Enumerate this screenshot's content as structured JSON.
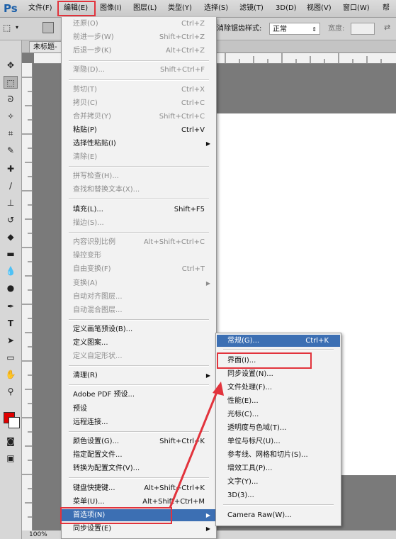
{
  "app": {
    "logo": "Ps"
  },
  "menubar": {
    "items": [
      {
        "label": "文件(F)"
      },
      {
        "label": "编辑(E)"
      },
      {
        "label": "图像(I)"
      },
      {
        "label": "图层(L)"
      },
      {
        "label": "类型(Y)"
      },
      {
        "label": "选择(S)"
      },
      {
        "label": "滤镜(T)"
      },
      {
        "label": "3D(D)"
      },
      {
        "label": "视图(V)"
      },
      {
        "label": "窗口(W)"
      },
      {
        "label": "帮"
      }
    ]
  },
  "options": {
    "partial_label": "消除锯齿",
    "style_label": "样式:",
    "style_value": "正常",
    "width_label": "宽度:"
  },
  "document": {
    "tab_title": "未标题-",
    "zoom": "100%"
  },
  "edit_menu": {
    "items": [
      {
        "label": "还原(O)",
        "shortcut": "Ctrl+Z",
        "disabled": true
      },
      {
        "label": "前进一步(W)",
        "shortcut": "Shift+Ctrl+Z",
        "disabled": true
      },
      {
        "label": "后退一步(K)",
        "shortcut": "Alt+Ctrl+Z",
        "disabled": true
      },
      {
        "label": "渐隐(D)...",
        "shortcut": "Shift+Ctrl+F",
        "disabled": true
      },
      {
        "label": "剪切(T)",
        "shortcut": "Ctrl+X",
        "disabled": true
      },
      {
        "label": "拷贝(C)",
        "shortcut": "Ctrl+C",
        "disabled": true
      },
      {
        "label": "合并拷贝(Y)",
        "shortcut": "Shift+Ctrl+C",
        "disabled": true
      },
      {
        "label": "粘贴(P)",
        "shortcut": "Ctrl+V",
        "disabled": false
      },
      {
        "label": "选择性粘贴(I)",
        "shortcut": "",
        "disabled": false
      },
      {
        "label": "清除(E)",
        "shortcut": "",
        "disabled": true
      },
      {
        "label": "拼写检查(H)...",
        "shortcut": "",
        "disabled": true
      },
      {
        "label": "查找和替换文本(X)...",
        "shortcut": "",
        "disabled": true
      },
      {
        "label": "填充(L)...",
        "shortcut": "Shift+F5",
        "disabled": false
      },
      {
        "label": "描边(S)...",
        "shortcut": "",
        "disabled": true
      },
      {
        "label": "内容识别比例",
        "shortcut": "Alt+Shift+Ctrl+C",
        "disabled": true
      },
      {
        "label": "操控变形",
        "shortcut": "",
        "disabled": true
      },
      {
        "label": "自由变换(F)",
        "shortcut": "Ctrl+T",
        "disabled": true
      },
      {
        "label": "变换(A)",
        "shortcut": "",
        "disabled": true
      },
      {
        "label": "自动对齐图层...",
        "shortcut": "",
        "disabled": true
      },
      {
        "label": "自动混合图层...",
        "shortcut": "",
        "disabled": true
      },
      {
        "label": "定义画笔预设(B)...",
        "shortcut": "",
        "disabled": false
      },
      {
        "label": "定义图案...",
        "shortcut": "",
        "disabled": false
      },
      {
        "label": "定义自定形状...",
        "shortcut": "",
        "disabled": true
      },
      {
        "label": "清理(R)",
        "shortcut": "",
        "disabled": false
      },
      {
        "label": "Adobe PDF 预设...",
        "shortcut": "",
        "disabled": false
      },
      {
        "label": "预设",
        "shortcut": "",
        "disabled": false
      },
      {
        "label": "远程连接...",
        "shortcut": "",
        "disabled": false
      },
      {
        "label": "颜色设置(G)...",
        "shortcut": "Shift+Ctrl+K",
        "disabled": false
      },
      {
        "label": "指定配置文件...",
        "shortcut": "",
        "disabled": false
      },
      {
        "label": "转换为配置文件(V)...",
        "shortcut": "",
        "disabled": false
      },
      {
        "label": "键盘快捷键...",
        "shortcut": "Alt+Shift+Ctrl+K",
        "disabled": false
      },
      {
        "label": "菜单(U)...",
        "shortcut": "Alt+Shift+Ctrl+M",
        "disabled": false
      },
      {
        "label": "首选项(N)",
        "shortcut": "",
        "disabled": false
      },
      {
        "label": "同步设置(E)",
        "shortcut": "",
        "disabled": false
      }
    ]
  },
  "preferences_submenu": {
    "items": [
      {
        "label": "常规(G)...",
        "shortcut": "Ctrl+K"
      },
      {
        "label": "界面(I)...",
        "shortcut": ""
      },
      {
        "label": "同步设置(N)...",
        "shortcut": ""
      },
      {
        "label": "文件处理(F)...",
        "shortcut": ""
      },
      {
        "label": "性能(E)...",
        "shortcut": ""
      },
      {
        "label": "光标(C)...",
        "shortcut": ""
      },
      {
        "label": "透明度与色域(T)...",
        "shortcut": ""
      },
      {
        "label": "单位与标尺(U)...",
        "shortcut": ""
      },
      {
        "label": "参考线、网格和切片(S)...",
        "shortcut": ""
      },
      {
        "label": "增效工具(P)...",
        "shortcut": ""
      },
      {
        "label": "文字(Y)...",
        "shortcut": ""
      },
      {
        "label": "3D(3)...",
        "shortcut": ""
      },
      {
        "label": "Camera Raw(W)...",
        "shortcut": ""
      }
    ]
  },
  "colors": {
    "highlight": "#3c6fb3",
    "annotation_red": "#e2333c",
    "foreground_swatch": "#e00000",
    "background_swatch": "#ffffff"
  }
}
